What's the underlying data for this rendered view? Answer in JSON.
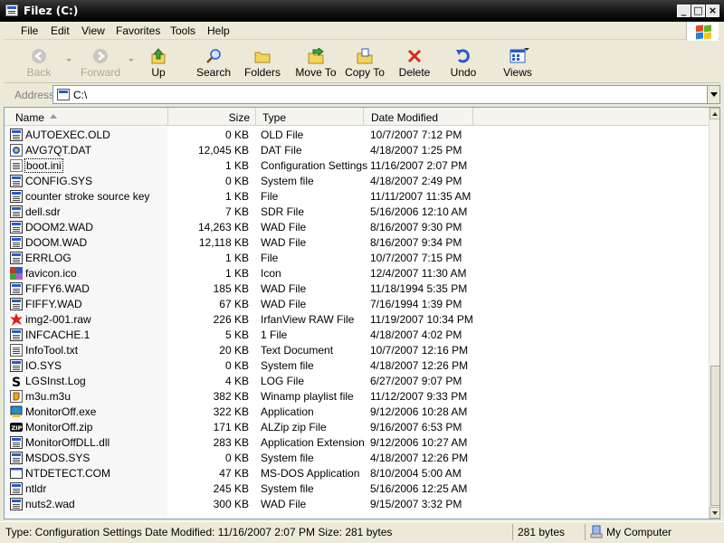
{
  "window": {
    "title": "Filez (C:)"
  },
  "menu": [
    "File",
    "Edit",
    "View",
    "Favorites",
    "Tools",
    "Help"
  ],
  "toolbar": {
    "back": "Back",
    "forward": "Forward",
    "up": "Up",
    "search": "Search",
    "folders": "Folders",
    "move_to": "Move To",
    "copy_to": "Copy To",
    "delete": "Delete",
    "undo": "Undo",
    "views": "Views"
  },
  "address": {
    "label": "Address",
    "value": "C:\\"
  },
  "columns": {
    "name": "Name",
    "size": "Size",
    "type": "Type",
    "date": "Date Modified"
  },
  "files": [
    {
      "name": "AUTOEXEC.OLD",
      "size": "0 KB",
      "type": "OLD File",
      "date": "10/7/2007 7:12 PM",
      "icon": "generic-file-icon"
    },
    {
      "name": "AVG7QT.DAT",
      "size": "12,045 KB",
      "type": "DAT File",
      "date": "4/18/2007 1:25 PM",
      "icon": "avg-icon"
    },
    {
      "name": "boot.ini",
      "size": "1 KB",
      "type": "Configuration Settings",
      "date": "11/16/2007 2:07 PM",
      "icon": "config-icon"
    },
    {
      "name": "CONFIG.SYS",
      "size": "0 KB",
      "type": "System file",
      "date": "4/18/2007 2:49 PM",
      "icon": "generic-file-icon"
    },
    {
      "name": "counter stroke source key",
      "size": "1 KB",
      "type": "File",
      "date": "11/11/2007 11:35 AM",
      "icon": "generic-file-icon"
    },
    {
      "name": "dell.sdr",
      "size": "7 KB",
      "type": "SDR File",
      "date": "5/16/2006 12:10 AM",
      "icon": "generic-file-icon"
    },
    {
      "name": "DOOM2.WAD",
      "size": "14,263 KB",
      "type": "WAD File",
      "date": "8/16/2007 9:30 PM",
      "icon": "generic-file-icon"
    },
    {
      "name": "DOOM.WAD",
      "size": "12,118 KB",
      "type": "WAD File",
      "date": "8/16/2007 9:34 PM",
      "icon": "generic-file-icon"
    },
    {
      "name": "ERRLOG",
      "size": "1 KB",
      "type": "File",
      "date": "10/7/2007 7:15 PM",
      "icon": "generic-file-icon"
    },
    {
      "name": "favicon.ico",
      "size": "1 KB",
      "type": "Icon",
      "date": "12/4/2007 11:30 AM",
      "icon": "ico-icon"
    },
    {
      "name": "FIFFY6.WAD",
      "size": "185 KB",
      "type": "WAD File",
      "date": "11/18/1994 5:35 PM",
      "icon": "generic-file-icon"
    },
    {
      "name": "FIFFY.WAD",
      "size": "67 KB",
      "type": "WAD File",
      "date": "7/16/1994 1:39 PM",
      "icon": "generic-file-icon"
    },
    {
      "name": "img2-001.raw",
      "size": "226 KB",
      "type": "IrfanView RAW File",
      "date": "11/19/2007 10:34 PM",
      "icon": "irfanview-icon"
    },
    {
      "name": "INFCACHE.1",
      "size": "5 KB",
      "type": "1 File",
      "date": "4/18/2007 4:02 PM",
      "icon": "generic-file-icon"
    },
    {
      "name": "InfoTool.txt",
      "size": "20 KB",
      "type": "Text Document",
      "date": "10/7/2007 12:16 PM",
      "icon": "text-file-icon"
    },
    {
      "name": "IO.SYS",
      "size": "0 KB",
      "type": "System file",
      "date": "4/18/2007 12:26 PM",
      "icon": "generic-file-icon"
    },
    {
      "name": "LGSInst.Log",
      "size": "4 KB",
      "type": "LOG File",
      "date": "6/27/2007 9:07 PM",
      "icon": "log-icon"
    },
    {
      "name": "m3u.m3u",
      "size": "382 KB",
      "type": "Winamp playlist file",
      "date": "11/12/2007 9:33 PM",
      "icon": "winamp-icon"
    },
    {
      "name": "MonitorOff.exe",
      "size": "322 KB",
      "type": "Application",
      "date": "9/12/2006 10:28 AM",
      "icon": "exe-icon"
    },
    {
      "name": "MonitorOff.zip",
      "size": "171 KB",
      "type": "ALZip zip File",
      "date": "9/16/2007 6:53 PM",
      "icon": "zip-icon"
    },
    {
      "name": "MonitorOffDLL.dll",
      "size": "283 KB",
      "type": "Application Extension",
      "date": "9/12/2006 10:27 AM",
      "icon": "generic-file-icon"
    },
    {
      "name": "MSDOS.SYS",
      "size": "0 KB",
      "type": "System file",
      "date": "4/18/2007 12:26 PM",
      "icon": "generic-file-icon"
    },
    {
      "name": "NTDETECT.COM",
      "size": "47 KB",
      "type": "MS-DOS Application",
      "date": "8/10/2004 5:00 AM",
      "icon": "dos-app-icon"
    },
    {
      "name": "ntldr",
      "size": "245 KB",
      "type": "System file",
      "date": "5/16/2006 12:25 AM",
      "icon": "generic-file-icon"
    },
    {
      "name": "nuts2.wad",
      "size": "300 KB",
      "type": "WAD File",
      "date": "9/15/2007 3:32 PM",
      "icon": "generic-file-icon"
    }
  ],
  "status": {
    "details": "Type: Configuration Settings Date Modified: 11/16/2007 2:07 PM Size: 281 bytes",
    "size": "281 bytes",
    "location": "My Computer"
  }
}
